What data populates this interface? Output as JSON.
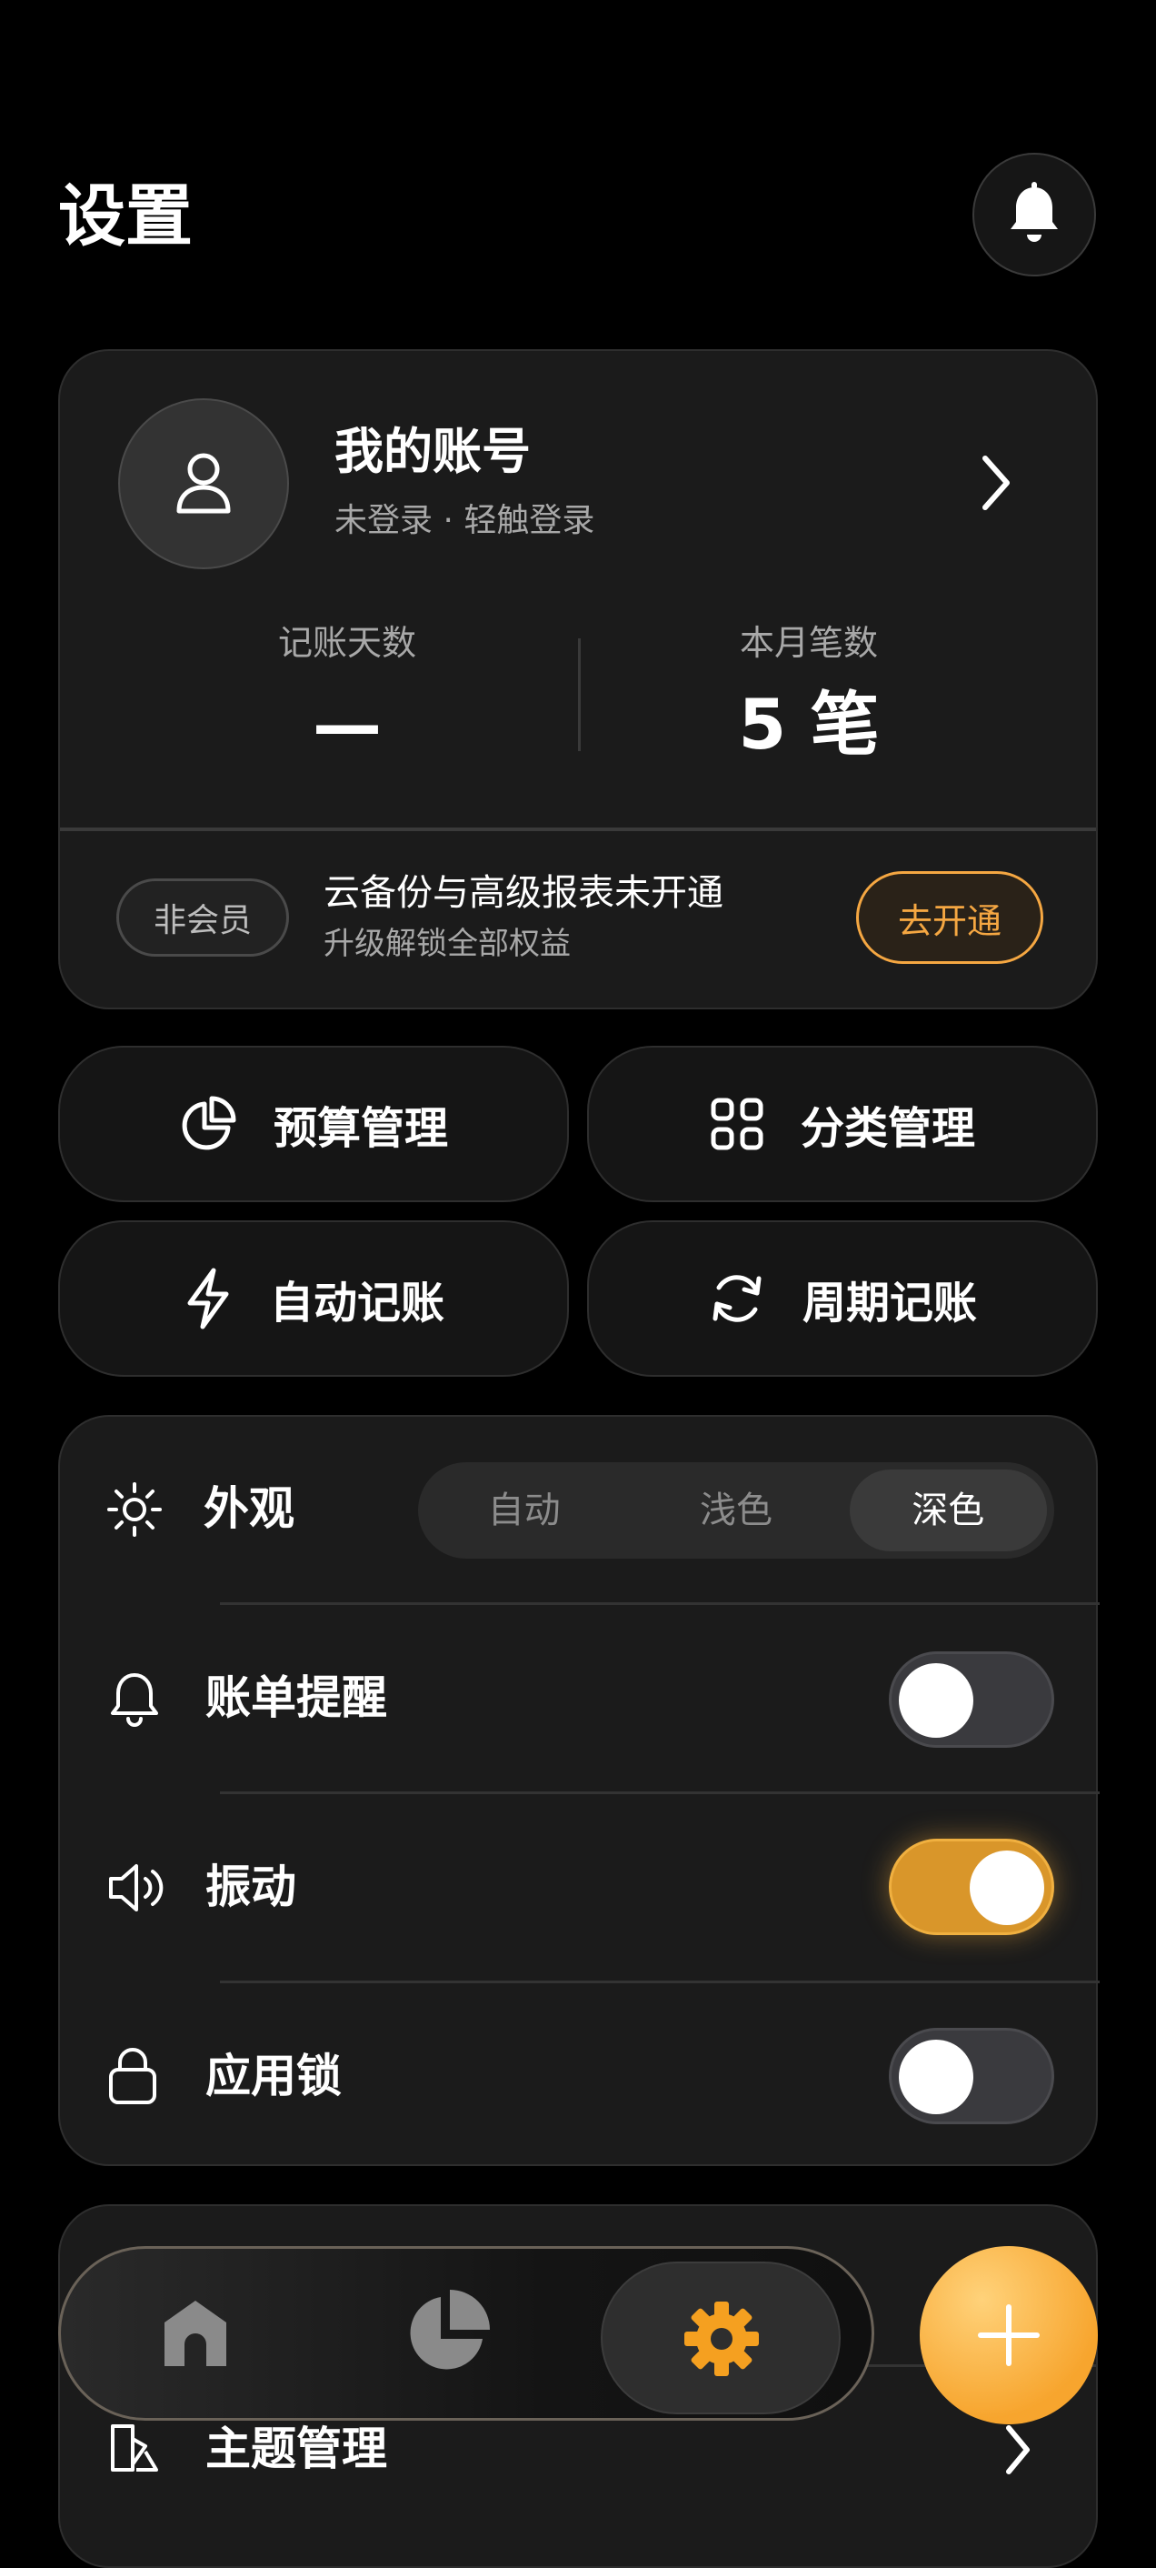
{
  "header": {
    "title": "设置",
    "bell_icon": "bell-icon"
  },
  "account": {
    "name": "我的账号",
    "status": "未登录 · 轻触登录",
    "stats": [
      {
        "label": "记账天数",
        "value": "—"
      },
      {
        "label": "本月笔数",
        "value": "5 笔"
      }
    ]
  },
  "membership": {
    "badge": "非会员",
    "title": "云备份与高级报表未开通",
    "subtitle": "升级解锁全部权益",
    "button": "去开通"
  },
  "quick_actions": [
    {
      "label": "预算管理",
      "icon": "pie-chart-icon"
    },
    {
      "label": "分类管理",
      "icon": "grid-icon"
    },
    {
      "label": "自动记账",
      "icon": "lightning-icon"
    },
    {
      "label": "周期记账",
      "icon": "refresh-icon"
    }
  ],
  "settings": {
    "appearance": {
      "label": "外观",
      "options": [
        "自动",
        "浅色",
        "深色"
      ],
      "selected": "深色"
    },
    "bill_reminder": {
      "label": "账单提醒",
      "enabled": false
    },
    "vibration": {
      "label": "振动",
      "enabled": true
    },
    "app_lock": {
      "label": "应用锁",
      "enabled": false
    },
    "theme": {
      "label": "主题管理"
    }
  },
  "tabbar": {
    "active": "settings",
    "items": [
      "home",
      "stats",
      "settings"
    ]
  },
  "colors": {
    "accent": "#f5a742",
    "background": "#000000",
    "card": "#1b1b1b"
  }
}
